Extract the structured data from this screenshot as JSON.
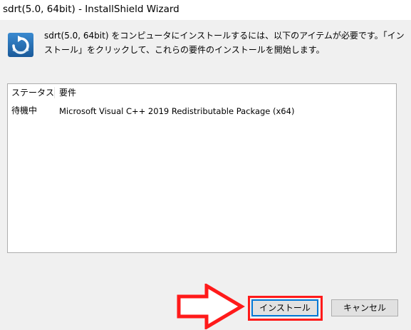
{
  "window": {
    "title": "sdrt(5.0, 64bit) - InstallShield Wizard"
  },
  "dialog": {
    "message": "sdrt(5.0, 64bit) をコンピュータにインストールするには、以下のアイテムが必要です。「インストール」をクリックして、これらの要件のインストールを開始します。",
    "icon": "installer-icon"
  },
  "requirements": {
    "headers": {
      "status": "ステータス",
      "requirement": "要件"
    },
    "rows": [
      {
        "status": "待機中",
        "requirement": "Microsoft Visual C++ 2019 Redistributable Package (x64)"
      }
    ]
  },
  "buttons": {
    "install": "インストール",
    "cancel": "キャンセル"
  },
  "annotation": {
    "arrow_color": "#ff1a1a",
    "highlight_color": "#ff1a1a",
    "arrow_icon": "right-arrow-icon"
  }
}
